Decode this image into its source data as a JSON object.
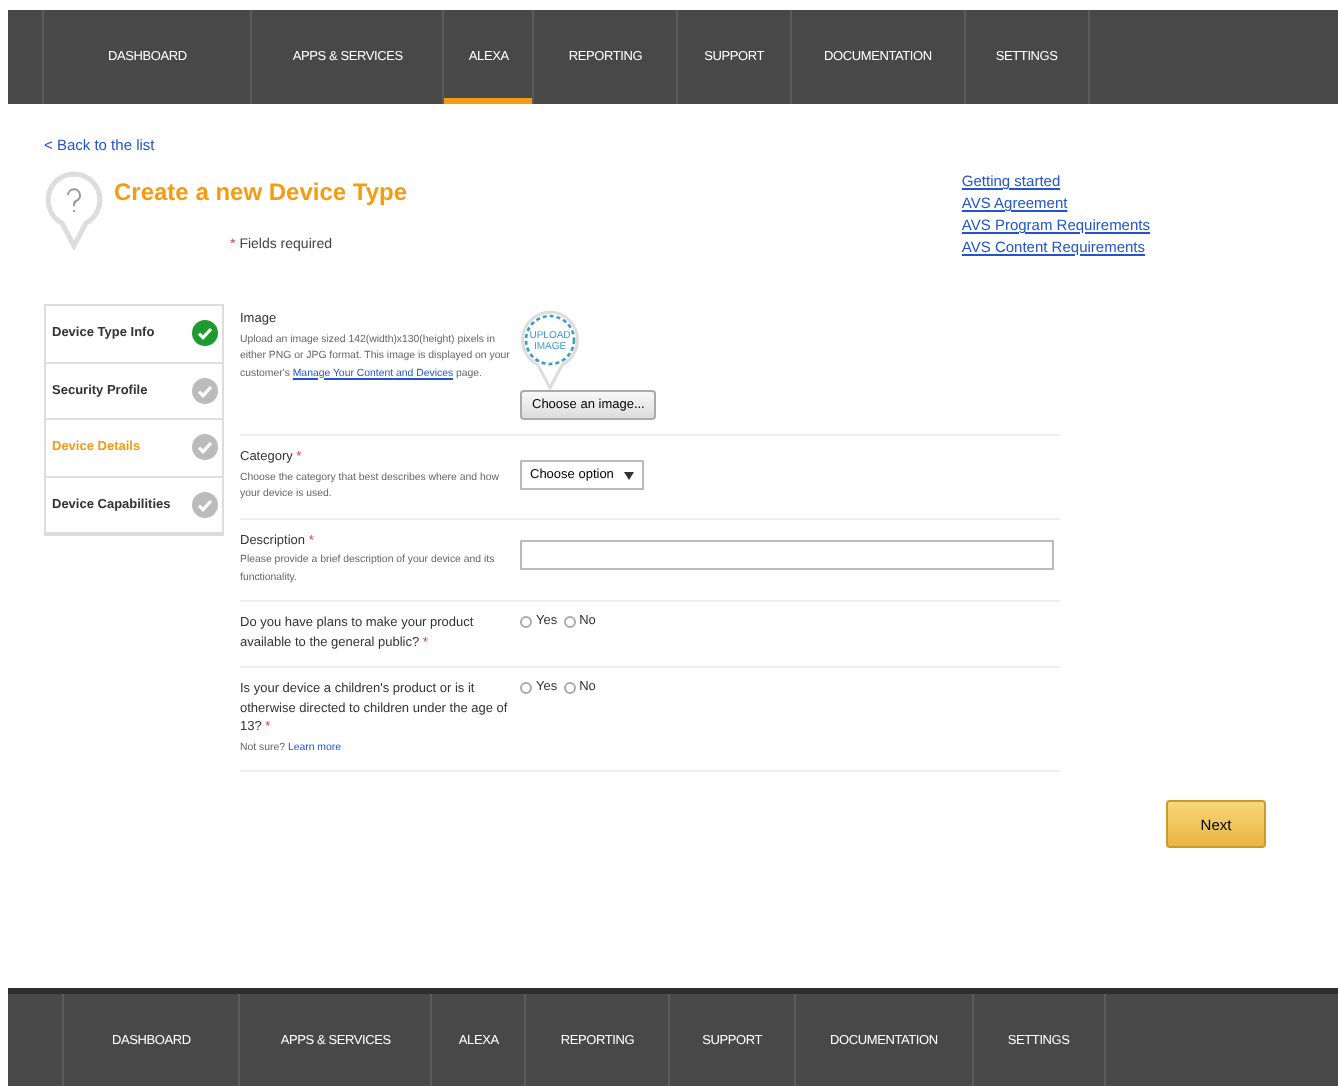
{
  "top_nav": [
    {
      "label": "DASHBOARD",
      "selected": false
    },
    {
      "label": "APPS & SERVICES",
      "selected": false
    },
    {
      "label": "ALEXA",
      "selected": true
    },
    {
      "label": "REPORTING",
      "selected": false
    },
    {
      "label": "SUPPORT",
      "selected": false
    },
    {
      "label": "DOCUMENTATION",
      "selected": false
    },
    {
      "label": "SETTINGS",
      "selected": false
    }
  ],
  "back_link": "< Back to the list",
  "title": "Create a new Device Type",
  "required_note": {
    "mark": "*",
    "text": "Fields required"
  },
  "help_links": [
    "Getting started",
    "AVS Agreement",
    "AVS Program Requirements",
    "AVS Content Requirements"
  ],
  "steps": [
    {
      "label": "Device Type Info",
      "done": true,
      "selected": false
    },
    {
      "label": "Security Profile",
      "done": false,
      "selected": false
    },
    {
      "label": "Device Details",
      "done": false,
      "selected": true
    },
    {
      "label": "Device Capabilities",
      "done": false,
      "selected": false
    }
  ],
  "fields": [
    {
      "kind": "image",
      "label": "Image",
      "required": false,
      "help": "Upload an image sized 142(width)x130(height) pixels in either PNG or JPG format. This image is displayed on your customer's ",
      "help_link": "Manage Your Content and Devices",
      "help_after": " page.",
      "placeholder_art": "UPLOAD IMAGE",
      "button": "Choose an image..."
    },
    {
      "kind": "select",
      "label": "Category",
      "required": true,
      "help": "Choose the category that best describes where and how your device is used.",
      "value": "Choose option"
    },
    {
      "kind": "text",
      "label": "Description",
      "required": true,
      "help": "Please provide a brief description of your device and its functionality."
    },
    {
      "kind": "radio",
      "label": "Do you have plans to make your product available to the general public?",
      "required": true,
      "options": [
        {
          "label": "Yes",
          "selected": false
        },
        {
          "label": "No",
          "selected": false
        }
      ]
    },
    {
      "kind": "radio",
      "label": "Is your device a children's product or is it otherwise directed to children under the age of 13?",
      "required": true,
      "note": "Not sure?",
      "note_link": "Learn more",
      "options": [
        {
          "label": "Yes",
          "selected": false
        },
        {
          "label": "No",
          "selected": false
        }
      ]
    }
  ],
  "next_button": "Next",
  "footer_nav": [
    "DASHBOARD",
    "APPS & SERVICES",
    "ALEXA",
    "REPORTING",
    "SUPPORT",
    "DOCUMENTATION",
    "SETTINGS"
  ]
}
